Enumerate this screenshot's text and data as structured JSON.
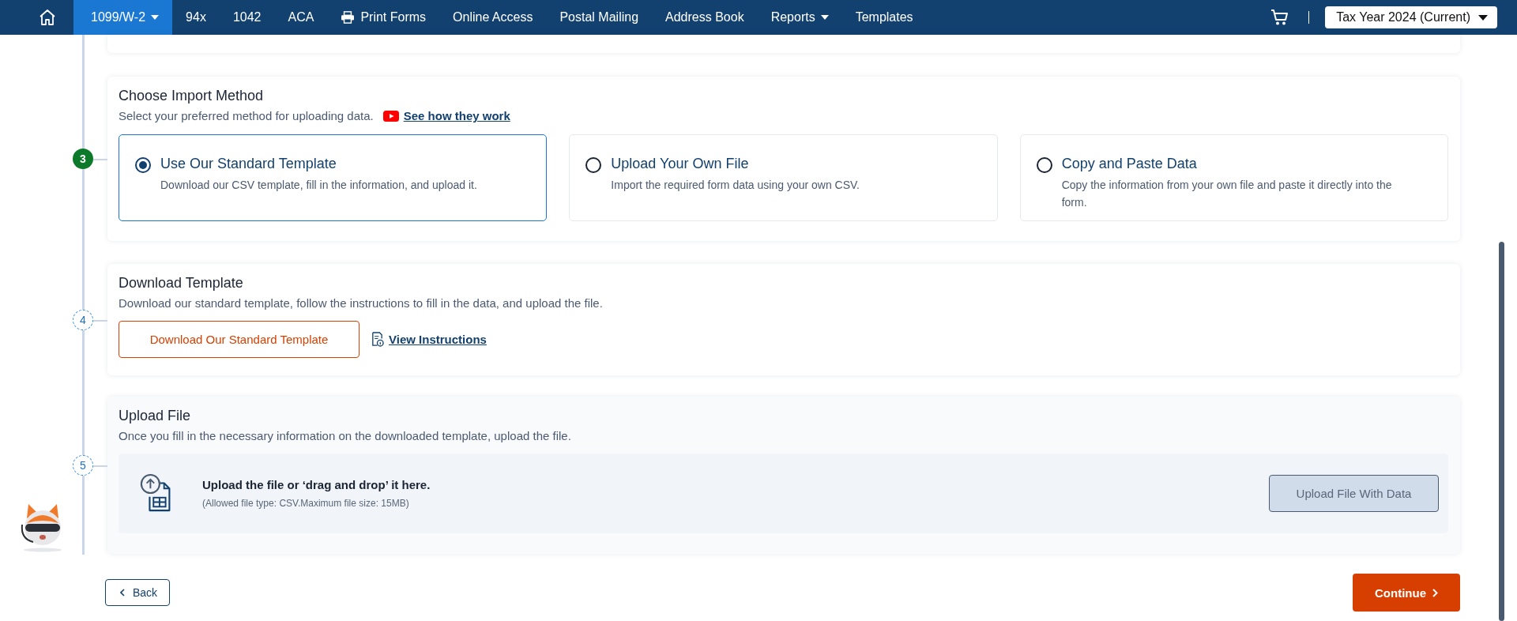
{
  "nav": {
    "items": [
      {
        "label": "1099/W-2",
        "selected": true,
        "kind": "menu"
      },
      {
        "label": "94x",
        "selected": false,
        "kind": "text"
      },
      {
        "label": "1042",
        "selected": false,
        "kind": "text"
      },
      {
        "label": "ACA",
        "selected": false,
        "kind": "text"
      },
      {
        "label": "Print Forms",
        "selected": false,
        "kind": "print"
      },
      {
        "label": "Online Access",
        "selected": false,
        "kind": "text"
      },
      {
        "label": "Postal Mailing",
        "selected": false,
        "kind": "text"
      },
      {
        "label": "Address Book",
        "selected": false,
        "kind": "text"
      },
      {
        "label": "Reports",
        "selected": false,
        "kind": "menu"
      },
      {
        "label": "Templates",
        "selected": false,
        "kind": "text"
      }
    ],
    "tax_year": "Tax Year 2024 (Current)"
  },
  "import_method": {
    "step": "3",
    "completed": true,
    "title": "Choose Import Method",
    "subtitle": "Select your preferred method for uploading data.",
    "video_link": "See how they work",
    "options": [
      {
        "title": "Use Our Standard Template",
        "description": "Download our CSV template, fill in the information, and upload it.",
        "selected": true
      },
      {
        "title": "Upload Your Own File",
        "description": "Import the required form data using your own CSV.",
        "selected": false
      },
      {
        "title": "Copy and Paste Data",
        "description": "Copy the information from your own file and paste it directly into the form.",
        "selected": false
      }
    ]
  },
  "download_template": {
    "step": "4",
    "completed": false,
    "title": "Download Template",
    "subtitle": "Download our standard template, follow the instructions to fill in the data, and upload the file.",
    "download_button": "Download Our Standard Template",
    "instructions_link": "View Instructions"
  },
  "upload_file": {
    "step": "5",
    "completed": false,
    "title": "Upload File",
    "subtitle": "Once you fill in the necessary information on the downloaded template, upload the file.",
    "drop_title": "Upload the file or ‘drag and drop’ it here.",
    "drop_hint": "(Allowed file type: CSV.Maximum file size: 15MB)",
    "upload_button": {
      "label": "Upload File With Data",
      "disabled": true
    }
  },
  "footer": {
    "back": "Back",
    "continue": "Continue"
  }
}
